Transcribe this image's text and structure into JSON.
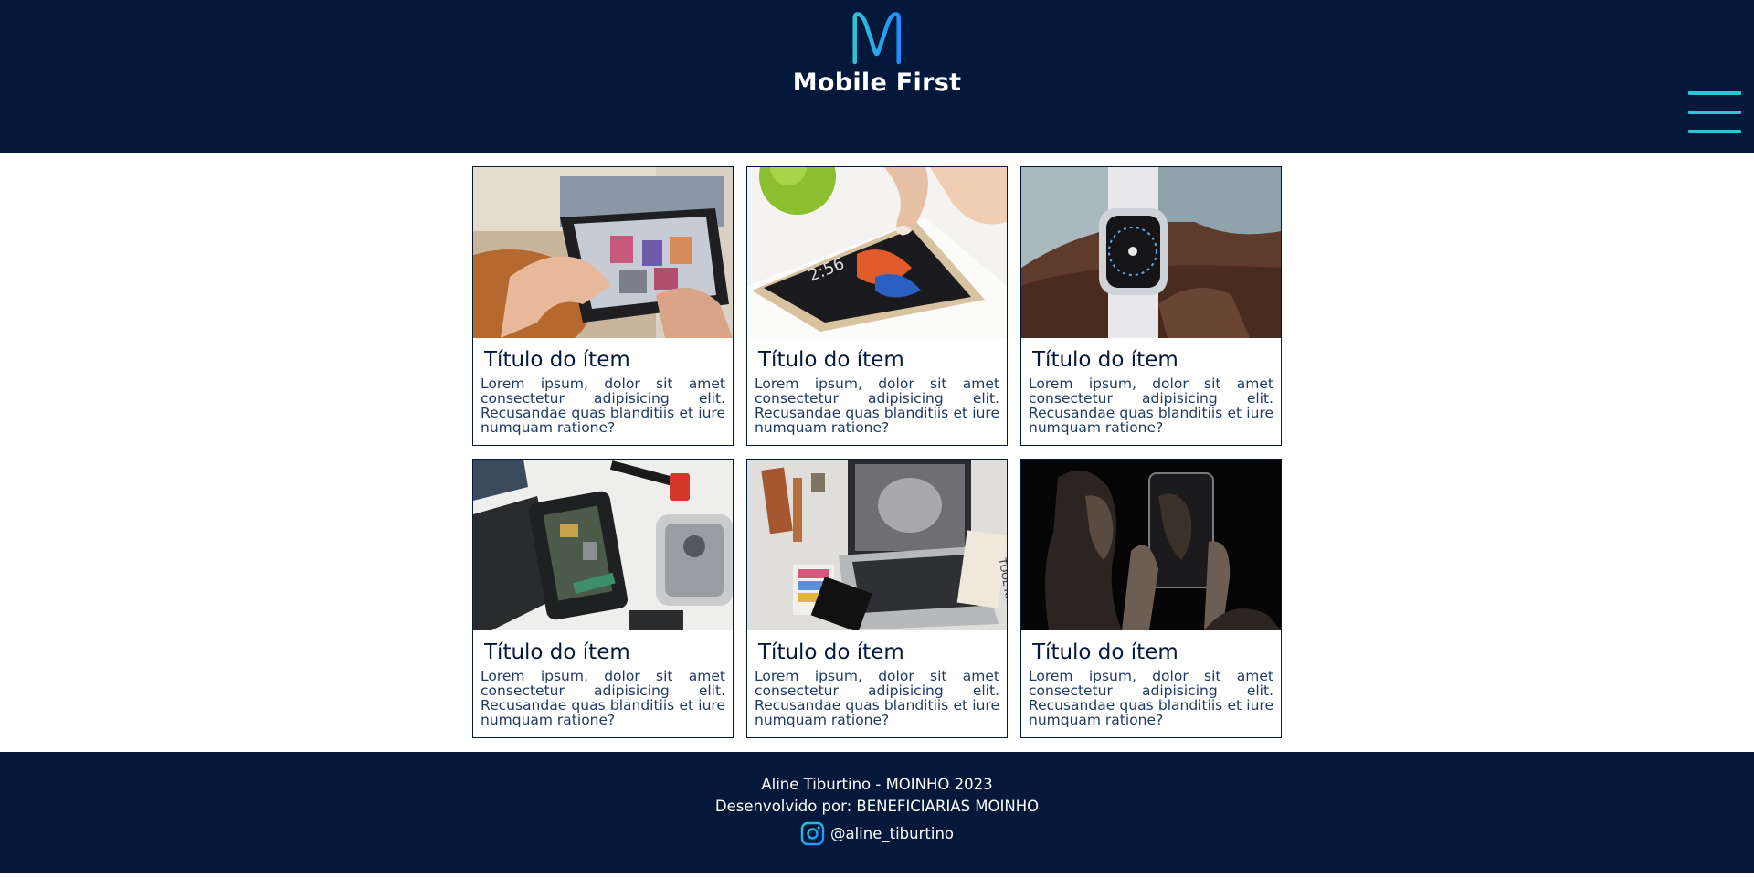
{
  "header": {
    "logo_letter": "M",
    "logo_text": "Mobile First",
    "menu_icon": "hamburger-menu-icon"
  },
  "colors": {
    "navy": "#03183a",
    "accent_cyan": "#2ec4d6",
    "accent_blue": "#1e90ff",
    "text_body": "#1f3b63"
  },
  "cards": [
    {
      "image": "tablet-in-hands-photo",
      "title": "Título do ítem",
      "text": "Lorem ipsum, dolor sit amet consectetur adipisicing elit. Recusandae quas blanditiis et iure numquam ratione?"
    },
    {
      "image": "smartphone-finger-photo",
      "title": "Título do ítem",
      "text": "Lorem ipsum, dolor sit amet consectetur adipisicing elit. Recusandae quas blanditiis et iure numquam ratione?"
    },
    {
      "image": "smartwatch-wrist-photo",
      "title": "Título do ítem",
      "text": "Lorem ipsum, dolor sit amet consectetur adipisicing elit. Recusandae quas blanditiis et iure numquam ratione?"
    },
    {
      "image": "disassembled-phones-photo",
      "title": "Título do ítem",
      "text": "Lorem ipsum, dolor sit amet consectetur adipisicing elit. Recusandae quas blanditiis et iure numquam ratione?"
    },
    {
      "image": "laptop-desk-photo",
      "title": "Título do ítem",
      "text": "Lorem ipsum, dolor sit amet consectetur adipisicing elit. Recusandae quas blanditiis et iure numquam ratione?"
    },
    {
      "image": "woman-phone-reflection-photo",
      "title": "Título do ítem",
      "text": "Lorem ipsum, dolor sit amet consectetur adipisicing elit. Recusandae quas blanditiis et iure numquam ratione?"
    }
  ],
  "footer": {
    "line1": "Aline Tiburtino - MOINHO 2023",
    "line2": "Desenvolvido por: BENEFICIARIAS MOINHO",
    "social_icon": "instagram-icon",
    "social_handle": "@aline_tiburtino"
  }
}
